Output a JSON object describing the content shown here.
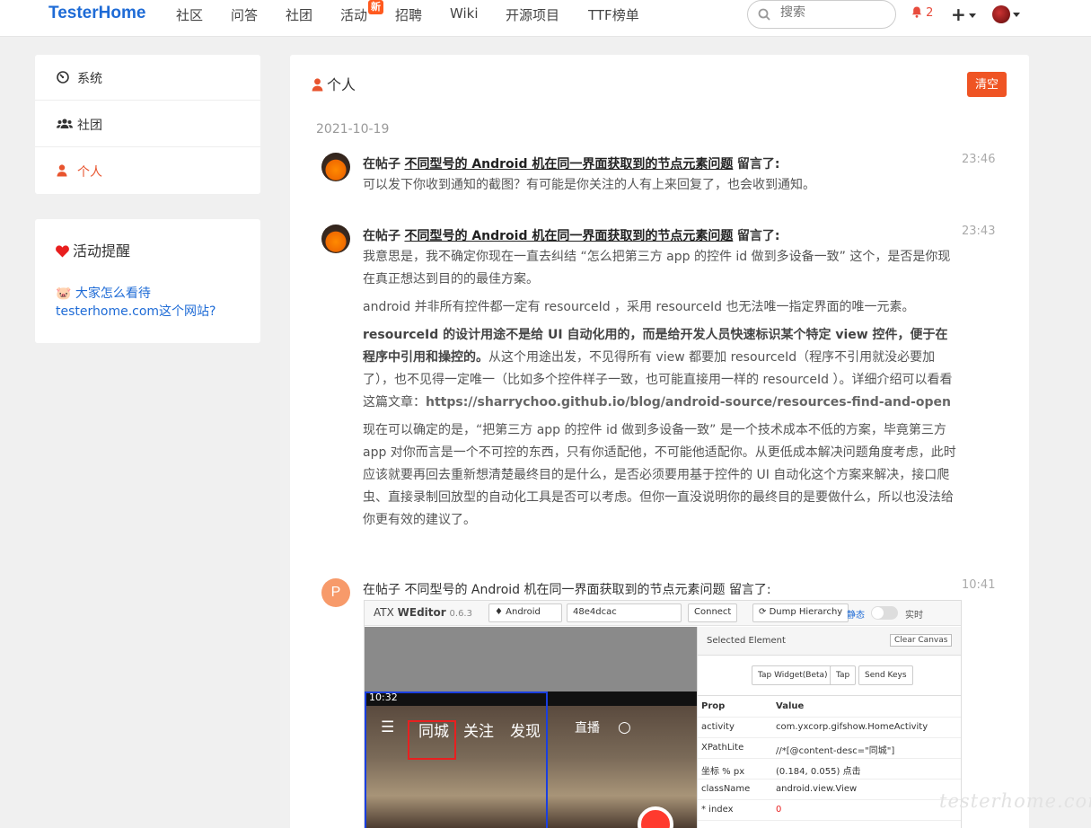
{
  "nav": {
    "brand": "TesterHome",
    "items": [
      "社区",
      "问答",
      "社团",
      "活动",
      "招聘",
      "Wiki",
      "开源项目",
      "TTF榜单"
    ],
    "new_badge": "新",
    "search_placeholder": "搜索",
    "notification_count": "2",
    "plus": "+"
  },
  "sidebar": {
    "items": [
      {
        "label": "系统",
        "icon": "dashboard-icon"
      },
      {
        "label": "社团",
        "icon": "users-icon"
      },
      {
        "label": "个人",
        "icon": "user-icon"
      }
    ]
  },
  "reminder": {
    "title": "活动提醒",
    "emoji": "🐷",
    "link": "大家怎么看待 testerhome.com这个网站?"
  },
  "main": {
    "title": "个人",
    "clear_label": "清空",
    "date": "2021-10-19",
    "notes": [
      {
        "prefix": "在帖子",
        "post": "不同型号的 Android 机在同一界面获取到的节点元素问题",
        "suffix": "留言了:",
        "time": "23:46",
        "body": [
          "可以发下你收到通知的截图？有可能是你关注的人有上来回复了，也会收到通知。"
        ]
      },
      {
        "prefix": "在帖子",
        "post": "不同型号的 Android 机在同一界面获取到的节点元素问题",
        "suffix": "留言了:",
        "time": "23:43",
        "body": [
          "我意思是，我不确定你现在一直去纠结 “怎么把第三方 app 的控件 id 做到多设备一致” 这个，是否是你现在真正想达到目的的最佳方案。",
          "android 并非所有控件都一定有 resourceId ，采用 resourceId 也无法唯一指定界面的唯一元素。",
          "resourceId 的设计用途不是给 UI 自动化用的，而是给开发人员快速标识某个特定 view 控件，便于在程序中引用和操控的。",
          "从这个用途出发，不见得所有 view 都要加 resourceId（程序不引用就没必要加了），也不见得一定唯一（比如多个控件样子一致，也可能直接用一样的 resourceId ）。详细介绍可以看看这篇文章：",
          "https://sharrychoo.github.io/blog/android-source/resources-find-and-open",
          "现在可以确定的是，“把第三方 app 的控件 id 做到多设备一致” 是一个技术成本不低的方案，毕竟第三方 app 对你而言是一个不可控的东西，只有你适配他，不可能他适配你。从更低成本解决问题角度考虑，此时应该就要再回去重新想清楚最终目的是什么，是否必须要用基于控件的 UI 自动化这个方案来解决，接口爬虫、直接录制回放型的自动化工具是否可以考虑。但你一直没说明你的最终目的是要做什么，所以也没法给你更有效的建议了。"
        ]
      },
      {
        "avatar_letter": "P",
        "prefix": "在帖子",
        "post": "不同型号的 Android 机在同一界面获取到的节点元素问题",
        "suffix": "留言了:",
        "time": "10:41"
      }
    ]
  },
  "screenshot": {
    "title_plain": "ATX",
    "title_bold": "WEditor",
    "version": "0.6.3",
    "platform": "Android",
    "serial": "48e4dcac",
    "connect": "Connect",
    "dump": "Dump Hierarchy",
    "mode_static": "静态",
    "mode_live": "实时",
    "phone_time": "10:32",
    "phone_tabs": [
      "同城",
      "关注",
      "发现",
      "直播"
    ],
    "selected_element": "Selected Element",
    "clear_canvas": "Clear Canvas",
    "buttons": [
      "Tap Widget(Beta)",
      "Tap",
      "Send Keys"
    ],
    "props_header": [
      "Prop",
      "Value"
    ],
    "props": [
      {
        "k": "activity",
        "v": "com.yxcorp.gifshow.HomeActivity"
      },
      {
        "k": "XPathLite",
        "v": "//*[@content-desc=\"同城\"]"
      },
      {
        "k": "坐标 % px",
        "v": "(0.184, 0.055) 点击"
      },
      {
        "k": "className",
        "v": "android.view.View"
      },
      {
        "k": "* index",
        "v": "0"
      }
    ]
  },
  "watermark": "testerhome.com",
  "colors": {
    "brand": "#1e6bd6",
    "accent": "#ef5424",
    "link": "#1e6bd6"
  }
}
